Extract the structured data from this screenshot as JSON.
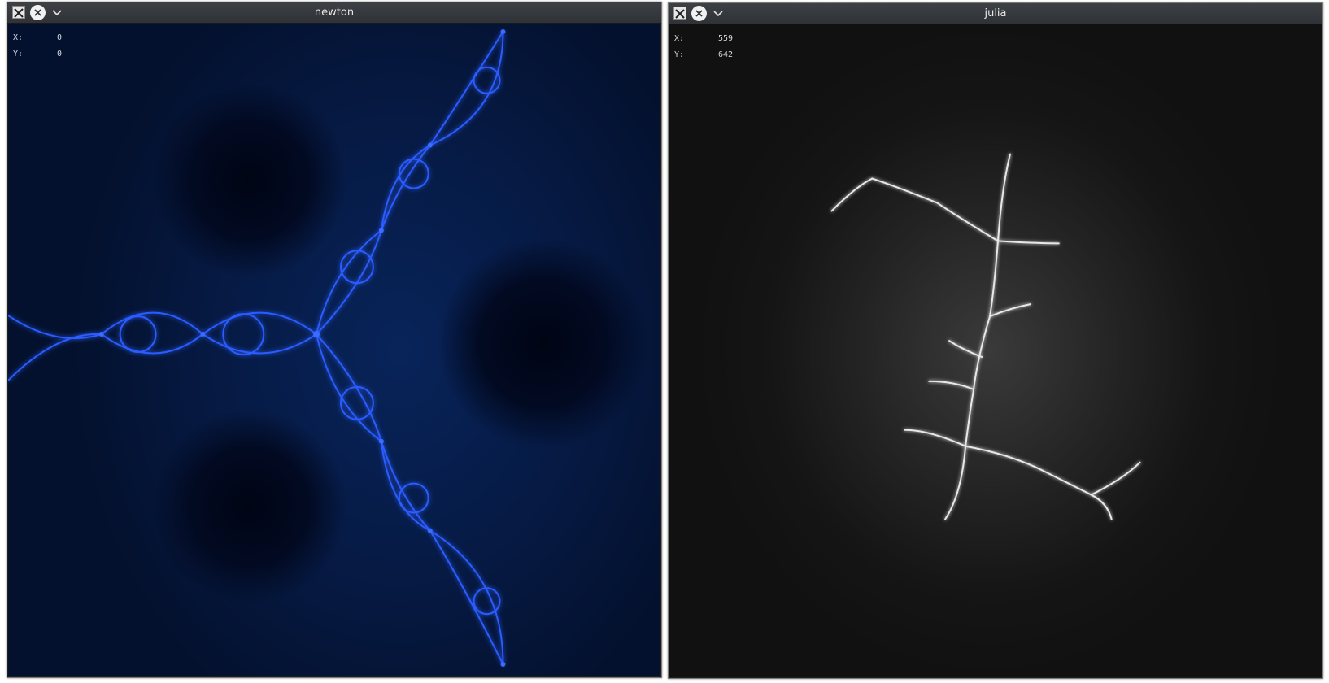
{
  "windows": [
    {
      "title": "newton",
      "coords": {
        "x_label": "X:",
        "x_value": "0",
        "y_label": "Y:",
        "y_value": "0"
      }
    },
    {
      "title": "julia",
      "coords": {
        "x_label": "X:",
        "x_value": "559",
        "y_label": "Y:",
        "y_value": "642"
      }
    }
  ],
  "icons": {
    "app": "x11-icon",
    "close": "close-icon",
    "menu": "chevron-down-icon"
  },
  "colors": {
    "newton_glow": "#2a5cff",
    "julia_branch": "#e8e8e8"
  }
}
